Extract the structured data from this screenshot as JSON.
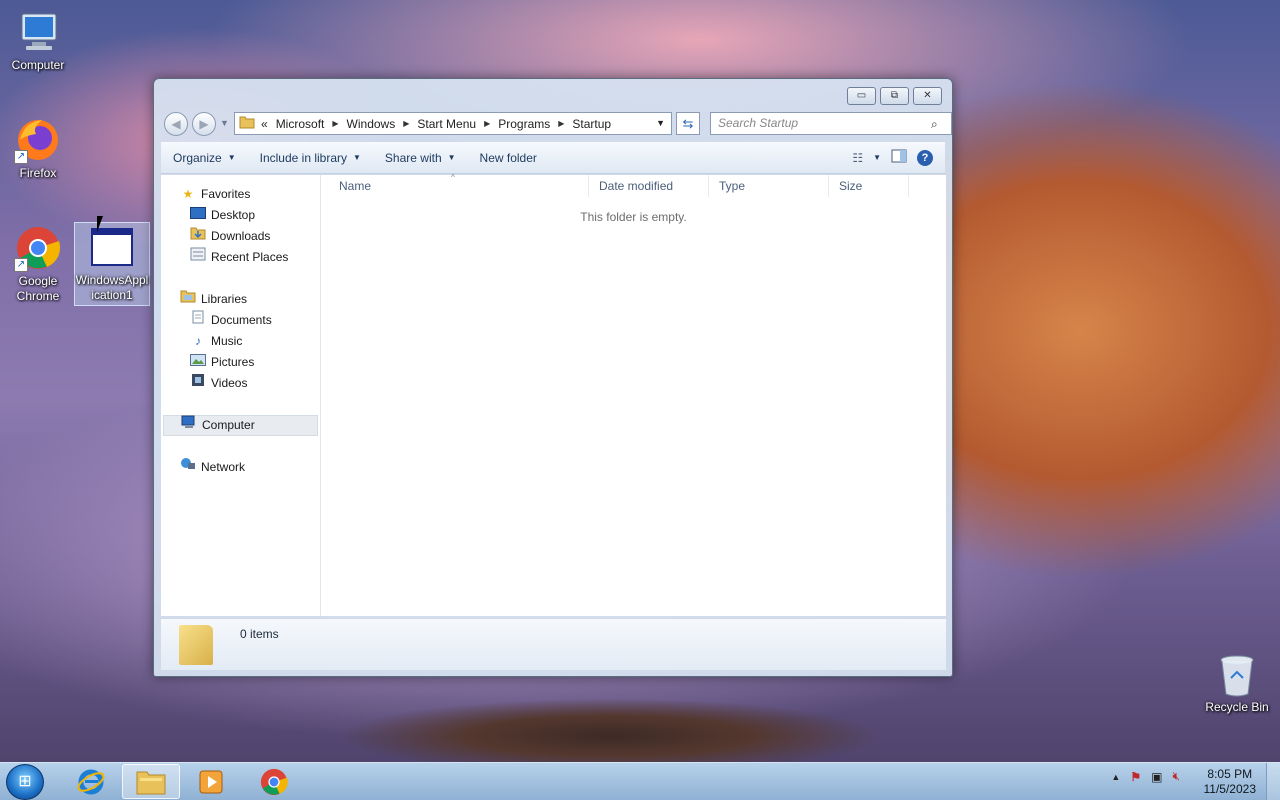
{
  "desktop": {
    "icons": [
      {
        "label": "Computer"
      },
      {
        "label": "Firefox"
      },
      {
        "label": "Google Chrome"
      },
      {
        "label": "WindowsApplication1"
      },
      {
        "label": "Recycle Bin"
      }
    ]
  },
  "window": {
    "caption_buttons": {
      "minimize": "▭",
      "maximize": "⧉",
      "close": "✕"
    },
    "address": {
      "overflow": "«",
      "crumbs": [
        "Microsoft",
        "Windows",
        "Start Menu",
        "Programs",
        "Startup"
      ]
    },
    "search": {
      "placeholder": "Search Startup"
    },
    "toolbar": {
      "organize": "Organize",
      "include_in_library": "Include in library",
      "share_with": "Share with",
      "new_folder": "New folder"
    },
    "nav_pane": {
      "favorites": "Favorites",
      "favorites_items": [
        "Desktop",
        "Downloads",
        "Recent Places"
      ],
      "libraries": "Libraries",
      "libraries_items": [
        "Documents",
        "Music",
        "Pictures",
        "Videos"
      ],
      "computer": "Computer",
      "network": "Network"
    },
    "columns": [
      "Name",
      "Date modified",
      "Type",
      "Size"
    ],
    "empty_message": "This folder is empty.",
    "details": {
      "count": "0 items"
    }
  },
  "taskbar": {
    "clock_time": "8:05 PM",
    "clock_date": "11/5/2023"
  },
  "colors": {
    "window_frame": "#d7e4f2",
    "taskbar": "#a6c3e0",
    "selection": "#e8ecf1"
  }
}
